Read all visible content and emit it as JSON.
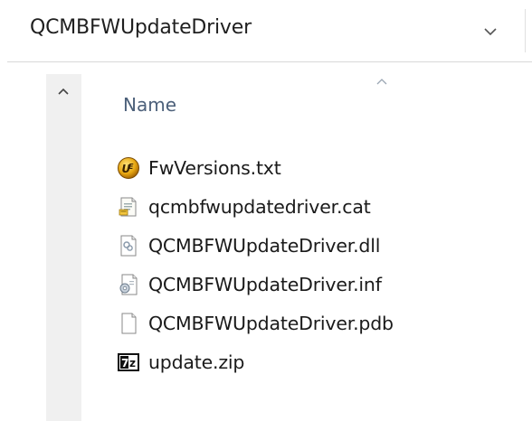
{
  "address_bar": {
    "path": "QCMBFWUpdateDriver",
    "dropdown_icon": "chevron-down-icon"
  },
  "nav_pane": {
    "scroll_up_icon": "chevron-up-icon"
  },
  "file_list": {
    "sort_icon": "sort-ascending-icon",
    "column_header": "Name",
    "files": [
      {
        "name": "FwVersions.txt",
        "icon": "ultraedit-file-icon"
      },
      {
        "name": "qcmbfwupdatedriver.cat",
        "icon": "security-catalog-file-icon"
      },
      {
        "name": "QCMBFWUpdateDriver.dll",
        "icon": "dll-file-icon"
      },
      {
        "name": "QCMBFWUpdateDriver.inf",
        "icon": "setup-information-file-icon"
      },
      {
        "name": "QCMBFWUpdateDriver.pdb",
        "icon": "blank-file-icon"
      },
      {
        "name": "update.zip",
        "icon": "7zip-archive-icon"
      }
    ]
  },
  "colors": {
    "header_text": "#4c607a",
    "file_text": "#1a1a1a",
    "divider": "#d9d9d9"
  }
}
